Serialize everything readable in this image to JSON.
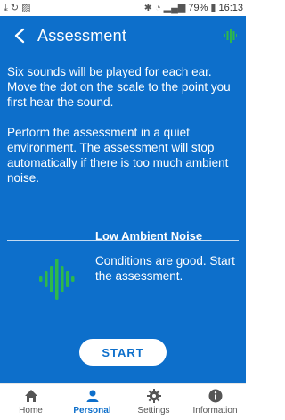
{
  "status_bar": {
    "battery": "79%",
    "time": "16:13"
  },
  "header": {
    "title": "Assessment"
  },
  "intro": {
    "paragraph1": "Six sounds will be played for each ear. Move the dot on the scale to the point you first hear the sound.",
    "paragraph2": "Perform the assessment in a quiet environment. The assessment will stop automatically if there is too much ambient noise."
  },
  "noise_status": {
    "title": "Low Ambient Noise",
    "description": "Conditions are good. Start the assessment."
  },
  "start_button": {
    "label": "START"
  },
  "bottom_nav": {
    "items": [
      {
        "label": "Home",
        "icon": "home-icon"
      },
      {
        "label": "Personal",
        "icon": "person-icon"
      },
      {
        "label": "Settings",
        "icon": "gear-icon"
      },
      {
        "label": "Information",
        "icon": "info-icon"
      }
    ],
    "active": "Personal"
  },
  "colors": {
    "primary": "#0d6fcb",
    "noise_ok": "#2db84b",
    "white": "#ffffff"
  }
}
